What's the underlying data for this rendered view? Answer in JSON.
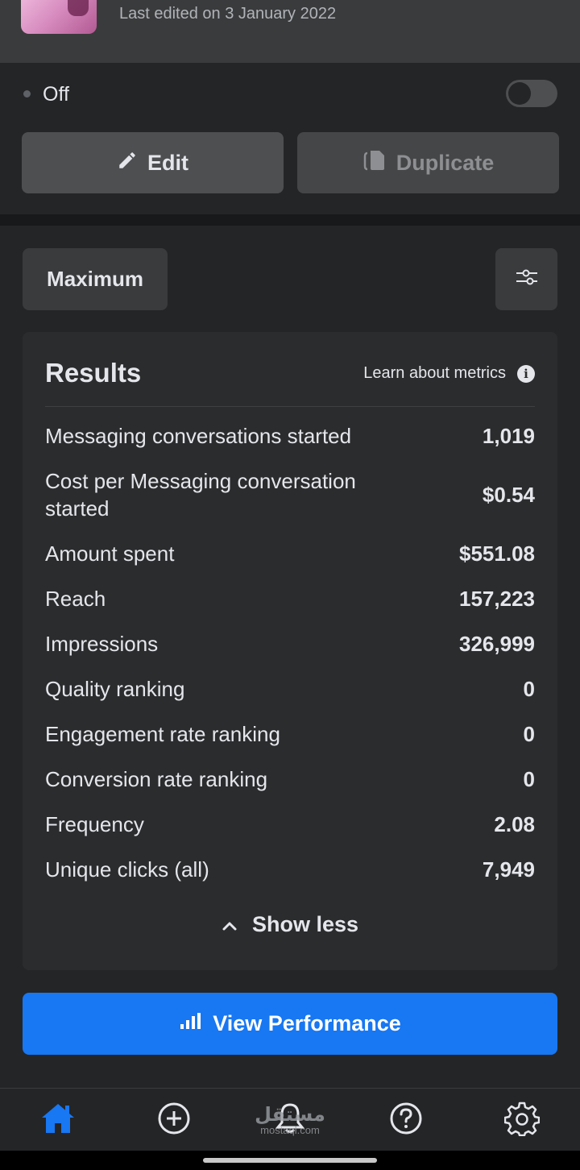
{
  "header": {
    "last_edited": "Last edited on 3 January 2022"
  },
  "campaign_controls": {
    "status": "Off",
    "toggle_on": false,
    "edit_label": "Edit",
    "duplicate_label": "Duplicate"
  },
  "filters": {
    "attribution_label": "Maximum",
    "settings_icon": "sliders-icon"
  },
  "results": {
    "title": "Results",
    "learn_link": "Learn about metrics",
    "metrics": [
      {
        "label": "Messaging conversations started",
        "value": "1,019"
      },
      {
        "label": "Cost per Messaging conversation started",
        "value": "$0.54"
      },
      {
        "label": "Amount spent",
        "value": "$551.08"
      },
      {
        "label": "Reach",
        "value": "157,223"
      },
      {
        "label": "Impressions",
        "value": "326,999"
      },
      {
        "label": "Quality ranking",
        "value": "0"
      },
      {
        "label": "Engagement rate ranking",
        "value": "0"
      },
      {
        "label": "Conversion rate ranking",
        "value": "0"
      },
      {
        "label": "Frequency",
        "value": "2.08"
      },
      {
        "label": "Unique clicks (all)",
        "value": "7,949"
      }
    ],
    "show_less": "Show less"
  },
  "view_performance": "View Performance",
  "bottom_nav": {
    "items": [
      {
        "icon": "home-icon",
        "active": true
      },
      {
        "icon": "plus-circle-icon",
        "active": false
      },
      {
        "icon": "bell-icon",
        "active": false
      },
      {
        "icon": "help-icon",
        "active": false
      },
      {
        "icon": "gear-icon",
        "active": false
      }
    ],
    "watermark_ar": "مستقل",
    "watermark_en": "mostaql.com"
  },
  "colors": {
    "accent": "#1877f2",
    "background": "#242526",
    "card": "#2b2c2d"
  }
}
